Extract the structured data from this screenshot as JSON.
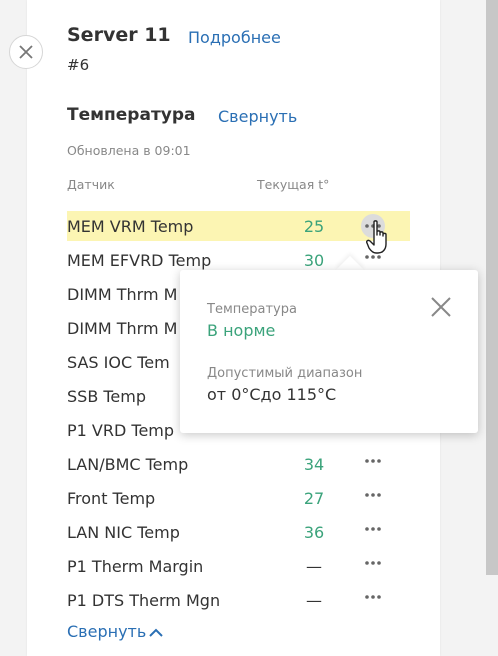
{
  "server": {
    "title": "Server 11",
    "details_link": "Подробнее",
    "number": "#6"
  },
  "section": {
    "title": "Температура",
    "collapse_link": "Свернуть",
    "updated": "Обновлена в 09:01",
    "col_sensor": "Датчик",
    "col_current": "Текущая t°"
  },
  "sensors": [
    {
      "name": "MEM VRM Temp",
      "value": "25"
    },
    {
      "name": "MEM EFVRD Temp",
      "value": "30"
    },
    {
      "name": "DIMM Thrm M",
      "value": ""
    },
    {
      "name": "DIMM Thrm M",
      "value": ""
    },
    {
      "name": "SAS IOC Tem",
      "value": ""
    },
    {
      "name": "SSB Temp",
      "value": ""
    },
    {
      "name": "P1 VRD Temp",
      "value": ""
    },
    {
      "name": "LAN/BMC Temp",
      "value": "34"
    },
    {
      "name": "Front Temp",
      "value": "27"
    },
    {
      "name": "LAN NIC Temp",
      "value": "36"
    },
    {
      "name": "P1 Therm Margin",
      "value": "—"
    },
    {
      "name": "P1 DTS Therm Mgn",
      "value": "—"
    }
  ],
  "bottom_collapse": "Свернуть",
  "tooltip": {
    "temp_label": "Температура",
    "temp_status": "В норме",
    "range_label": "Допустимый диапазон",
    "range_value": "от 0°Сдо 115°С"
  },
  "colors": {
    "link": "#2a6fb4",
    "ok_green": "#3ba37b",
    "highlight": "#fcf5b3"
  },
  "icons": {
    "panel_close": "close-icon",
    "row_menu": "more-horizontal-icon",
    "cursor": "hand-pointer-icon",
    "chevron": "chevron-up-icon"
  }
}
